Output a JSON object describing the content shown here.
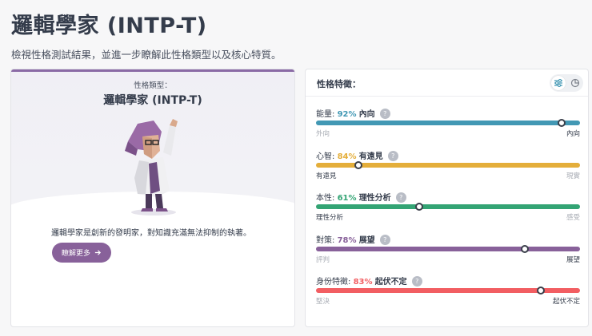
{
  "header": {
    "title": "邏輯學家 (INTP-T)",
    "subtitle": "檢視性格測試結果，並進一步瞭解此性格類型以及核心特質。"
  },
  "type_card": {
    "label": "性格類型：",
    "name": "邏輯學家 (INTP-T)",
    "description": "邏輯學家是創新的發明家，對知識充滿無法抑制的執著。",
    "button_label": "瞭解更多",
    "button_icon": "arrow-right-icon"
  },
  "traits_card": {
    "title": "性格特徵：",
    "toggle_icons": [
      "sliders-icon",
      "pie-chart-icon"
    ],
    "help_glyph": "?",
    "traits": [
      {
        "name": "能量:",
        "pct": "92%",
        "side": "內向",
        "left": "外向",
        "right": "內向",
        "value": 0.93,
        "color": "#4298b4",
        "dim": "left"
      },
      {
        "name": "心智:",
        "pct": "84%",
        "side": "有遠見",
        "left": "有遠見",
        "right": "現實",
        "value": 0.16,
        "color": "#e4ae3a",
        "dim": "right"
      },
      {
        "name": "本性:",
        "pct": "61%",
        "side": "理性分析",
        "left": "理性分析",
        "right": "感受",
        "value": 0.39,
        "color": "#33a474",
        "dim": "right"
      },
      {
        "name": "對策:",
        "pct": "78%",
        "side": "展望",
        "left": "評判",
        "right": "展望",
        "value": 0.79,
        "color": "#88619a",
        "dim": "left"
      },
      {
        "name": "身份特徵:",
        "pct": "83%",
        "side": "起伏不定",
        "left": "堅決",
        "right": "起伏不定",
        "value": 0.85,
        "color": "#f25e62",
        "dim": "left"
      }
    ]
  }
}
